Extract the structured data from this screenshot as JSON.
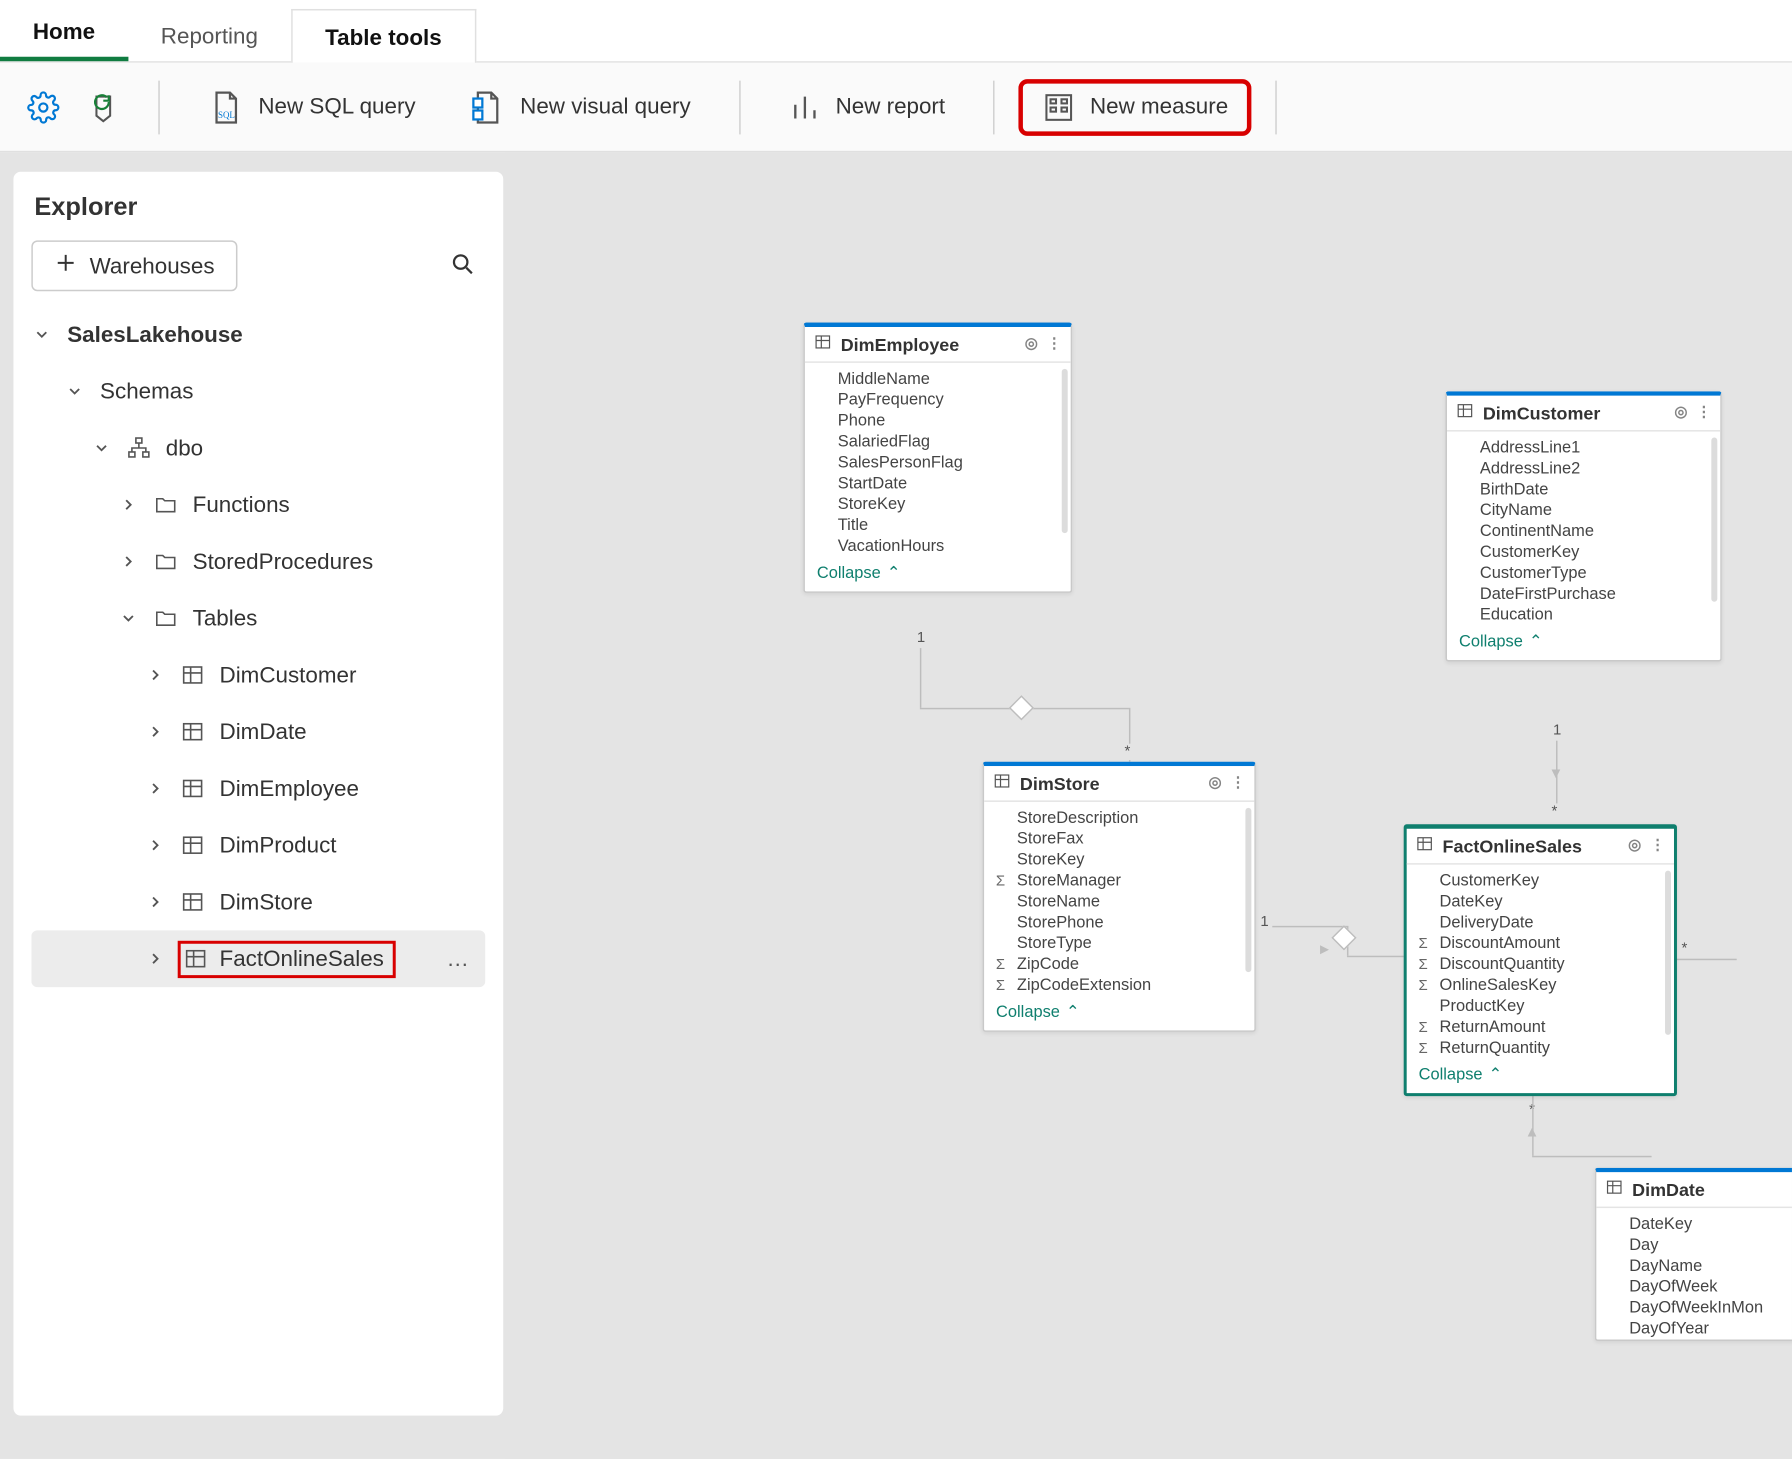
{
  "tabs": {
    "home": "Home",
    "reporting": "Reporting",
    "table_tools": "Table tools"
  },
  "ribbon": {
    "new_sql_query": "New SQL query",
    "new_visual_query": "New visual query",
    "new_report": "New report",
    "new_measure": "New measure"
  },
  "explorer": {
    "title": "Explorer",
    "add_button": "Warehouses",
    "root": "SalesLakehouse",
    "schemas": "Schemas",
    "dbo": "dbo",
    "functions": "Functions",
    "stored_procs": "StoredProcedures",
    "tables": "Tables",
    "tbl": {
      "dimcustomer": "DimCustomer",
      "dimdate": "DimDate",
      "dimemployee": "DimEmployee",
      "dimproduct": "DimProduct",
      "dimstore": "DimStore",
      "factonlinesales": "FactOnlineSales"
    },
    "more": "…"
  },
  "diagram": {
    "collapse": "Collapse",
    "entities": {
      "DimEmployee": {
        "title": "DimEmployee",
        "fields": [
          "MiddleName",
          "PayFrequency",
          "Phone",
          "SalariedFlag",
          "SalesPersonFlag",
          "StartDate",
          "StoreKey",
          "Title",
          "VacationHours"
        ]
      },
      "DimCustomer": {
        "title": "DimCustomer",
        "fields": [
          "AddressLine1",
          "AddressLine2",
          "BirthDate",
          "CityName",
          "ContinentName",
          "CustomerKey",
          "CustomerType",
          "DateFirstPurchase",
          "Education"
        ]
      },
      "DimStore": {
        "title": "DimStore",
        "fields": [
          {
            "name": "StoreDescription"
          },
          {
            "name": "StoreFax"
          },
          {
            "name": "StoreKey"
          },
          {
            "name": "StoreManager",
            "sigma": true
          },
          {
            "name": "StoreName"
          },
          {
            "name": "StorePhone"
          },
          {
            "name": "StoreType"
          },
          {
            "name": "ZipCode",
            "sigma": true
          },
          {
            "name": "ZipCodeExtension",
            "sigma": true
          }
        ]
      },
      "FactOnlineSales": {
        "title": "FactOnlineSales",
        "fields": [
          {
            "name": "CustomerKey"
          },
          {
            "name": "DateKey"
          },
          {
            "name": "DeliveryDate"
          },
          {
            "name": "DiscountAmount",
            "sigma": true
          },
          {
            "name": "DiscountQuantity",
            "sigma": true
          },
          {
            "name": "OnlineSalesKey",
            "sigma": true
          },
          {
            "name": "ProductKey"
          },
          {
            "name": "ReturnAmount",
            "sigma": true
          },
          {
            "name": "ReturnQuantity",
            "sigma": true
          }
        ]
      },
      "DimDate": {
        "title": "DimDate",
        "fields": [
          "DateKey",
          "Day",
          "DayName",
          "DayOfWeek",
          "DayOfWeekInMon",
          "DayOfYear"
        ]
      }
    }
  },
  "card": {
    "one": "1",
    "many": "*"
  }
}
